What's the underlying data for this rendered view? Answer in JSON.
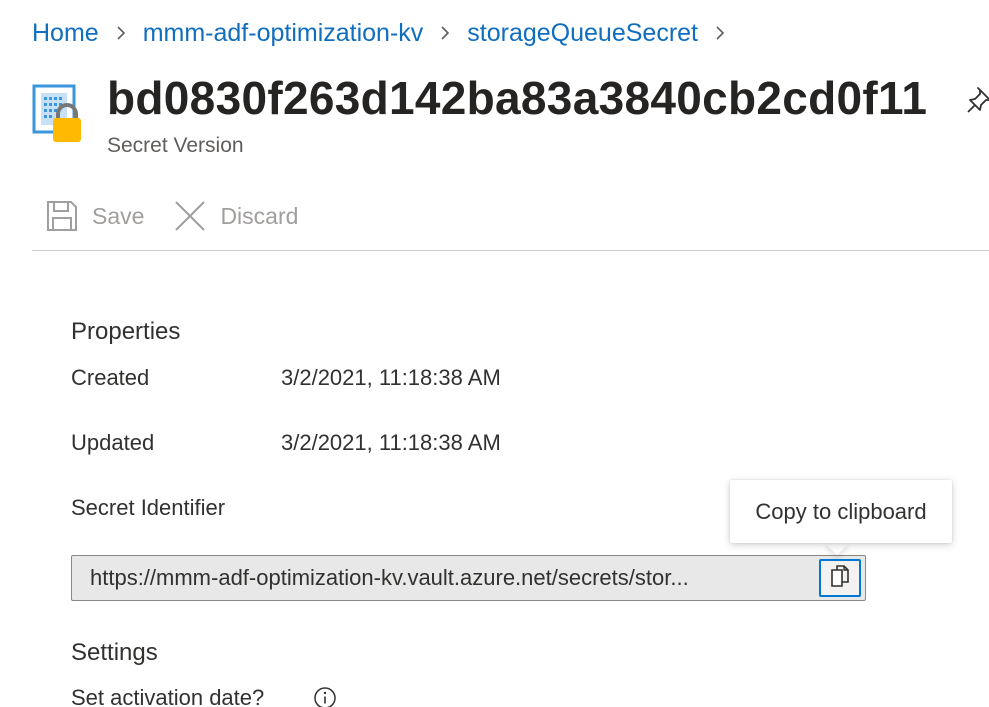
{
  "breadcrumb": {
    "items": [
      {
        "label": "Home"
      },
      {
        "label": "mmm-adf-optimization-kv"
      },
      {
        "label": "storageQueueSecret"
      }
    ],
    "separator_icon": "chevron-right-icon"
  },
  "header": {
    "icon": "key-vault-secret-lock-icon",
    "title": "bd0830f263d142ba83a3840cb2cd0f11",
    "subtitle": "Secret Version",
    "pin_icon": "pin-icon"
  },
  "toolbar": {
    "save_label": "Save",
    "save_icon": "save-icon",
    "discard_label": "Discard",
    "discard_icon": "close-icon",
    "state": "disabled"
  },
  "properties": {
    "heading": "Properties",
    "created_label": "Created",
    "created_value": "3/2/2021, 11:18:38 AM",
    "updated_label": "Updated",
    "updated_value": "3/2/2021, 11:18:38 AM",
    "identifier_label": "Secret Identifier",
    "identifier_value": "https://mmm-adf-optimization-kv.vault.azure.net/secrets/stor...",
    "copy_icon": "copy-icon"
  },
  "tooltip": {
    "text": "Copy to clipboard"
  },
  "settings": {
    "heading": "Settings",
    "activation_label": "Set activation date?",
    "info_icon": "info-icon"
  },
  "colors": {
    "link": "#106ebe",
    "accent": "#0078d4",
    "disabled_text": "#a19f9d",
    "lock_yellow": "#ffb900",
    "field_bg": "#e8e8e8"
  }
}
